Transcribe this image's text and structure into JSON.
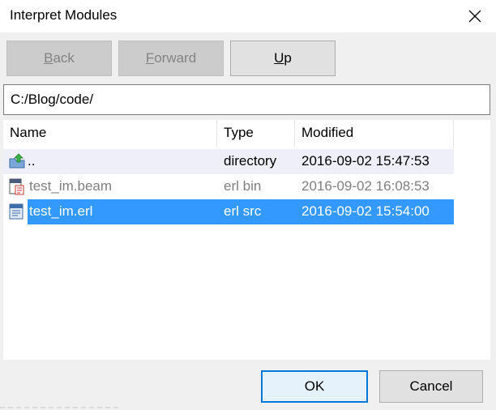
{
  "window": {
    "title": "Interpret Modules"
  },
  "nav": {
    "back": {
      "accel": "B",
      "rest": "ack"
    },
    "forward": {
      "accel": "F",
      "rest": "orward"
    },
    "up": {
      "accel": "U",
      "rest": "p"
    }
  },
  "path": {
    "value": "C:/Blog/code/"
  },
  "columns": {
    "name": "Name",
    "type": "Type",
    "modified": "Modified"
  },
  "rows": [
    {
      "name": "..",
      "type": "directory",
      "modified": "2016-09-02 15:47:53",
      "icon": "folder-up-icon"
    },
    {
      "name": "test_im.beam",
      "type": "erl bin",
      "modified": "2016-09-02 16:08:53",
      "icon": "beam-file-icon"
    },
    {
      "name": "test_im.erl",
      "type": "erl src",
      "modified": "2016-09-02 15:54:00",
      "icon": "erl-file-icon"
    }
  ],
  "dialog": {
    "ok": "OK",
    "cancel": "Cancel"
  },
  "colors": {
    "selection": "#3399ff",
    "alt_row": "#efeff9",
    "dim_text": "#7f7f7f",
    "focus_border": "#0078d7"
  }
}
